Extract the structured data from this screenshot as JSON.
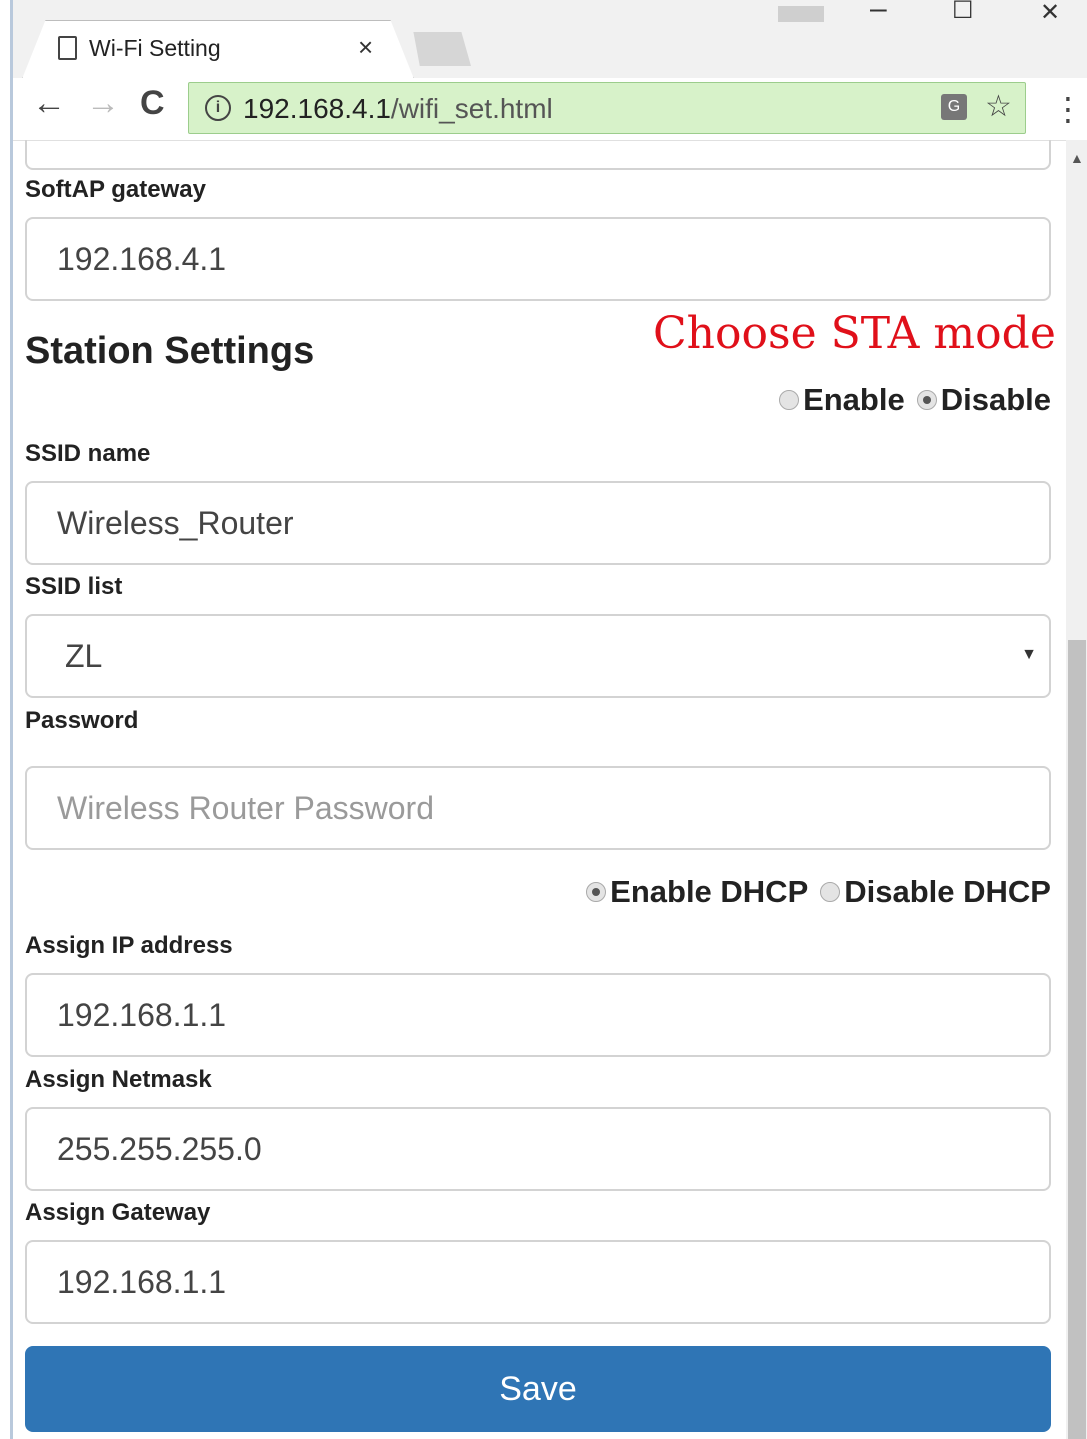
{
  "browser": {
    "tab_title": "Wi-Fi Setting",
    "tab_close": "×",
    "url_host": "192.168.4.1",
    "url_path": "/wifi_set.html",
    "win_min": "–",
    "win_max": "☐",
    "win_close": "✕",
    "back": "←",
    "forward": "→",
    "reload": "C",
    "star": "☆",
    "menu": "⋮",
    "info": "i",
    "translate": "G"
  },
  "softap": {
    "gateway_label": "SoftAP gateway",
    "gateway_value": "192.168.4.1"
  },
  "station": {
    "title": "Station Settings",
    "annotation": "Choose STA mode",
    "enable_label": "Enable",
    "disable_label": "Disable",
    "selected": "Disable",
    "ssid_name_label": "SSID name",
    "ssid_name_value": "Wireless_Router",
    "ssid_list_label": "SSID list",
    "ssid_list_value": "ZL",
    "password_label": "Password",
    "password_placeholder": "Wireless Router Password",
    "dhcp_enable_label": "Enable DHCP",
    "dhcp_disable_label": "Disable DHCP",
    "dhcp_selected": "Enable DHCP",
    "ip_label": "Assign IP address",
    "ip_value": "192.168.1.1",
    "netmask_label": "Assign Netmask",
    "netmask_value": "255.255.255.0",
    "gateway_label": "Assign Gateway",
    "gateway_value": "192.168.1.1"
  },
  "save_label": "Save",
  "colors": {
    "accent": "#2f75b5",
    "annotation": "#e0101a",
    "omnibox": "#d7f2c9"
  }
}
